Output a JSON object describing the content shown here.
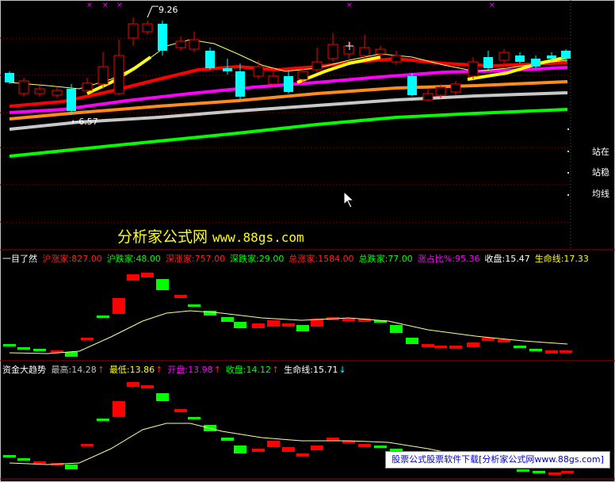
{
  "colors": {
    "background": "#000000",
    "up": "#ff0000",
    "down": "#00ffff",
    "ma_yellow": "#ffff00",
    "ma_red": "#ff0000",
    "ma_magenta": "#ff00ff",
    "ma_orange": "#ff8c1a",
    "ma_silver": "#c8c8c8",
    "ma_green": "#00ff00",
    "grid": "#8b0000"
  },
  "main_chart": {
    "high_marker": "9.26",
    "low_marker": "6.57",
    "right_labels": [
      "站在",
      "站稳",
      "均线"
    ]
  },
  "watermark": {
    "name": "分析家公式网",
    "url": "www.88gs.com"
  },
  "panel1": {
    "title": "一目了然",
    "items": [
      {
        "label": "沪涨家:",
        "value": "827.00",
        "color": "#ff2020"
      },
      {
        "label": "沪跌家:",
        "value": "48.00",
        "color": "#00ff00"
      },
      {
        "label": "深涨家:",
        "value": "757.00",
        "color": "#ff2020"
      },
      {
        "label": "深跌家:",
        "value": "29.00",
        "color": "#00ff00"
      },
      {
        "label": "总涨家:",
        "value": "1584.00",
        "color": "#ff2020"
      },
      {
        "label": "总跌家:",
        "value": "77.00",
        "color": "#00ff00"
      },
      {
        "label": "涨占比%:",
        "value": "95.36",
        "color": "#ff00ff"
      },
      {
        "label": "收盘:",
        "value": "15.47",
        "color": "#ffffff"
      },
      {
        "label": "生命线:",
        "value": "17.33",
        "color": "#ffff00"
      }
    ]
  },
  "panel2": {
    "title": "资金大趋势",
    "items": [
      {
        "label": "最高:",
        "value": "14.28",
        "color": "#c0c0c0",
        "arrow": "↑",
        "arrow_color": "#ff2020"
      },
      {
        "label": "最低:",
        "value": "13.86",
        "color": "#ffff00",
        "arrow": "↑",
        "arrow_color": "#ff2020"
      },
      {
        "label": "开盘:",
        "value": "13.98",
        "color": "#ff00ff",
        "arrow": "↑",
        "arrow_color": "#ff2020"
      },
      {
        "label": "收盘:",
        "value": "14.12",
        "color": "#00ff00",
        "arrow": "↑",
        "arrow_color": "#ff2020"
      },
      {
        "label": "生命线:",
        "value": "15.71",
        "color": "#ffffff",
        "arrow": "↓",
        "arrow_color": "#00ffff"
      }
    ]
  },
  "banner": {
    "text": "股票公式股票软件下载[分析家公式网www.88gs.com]"
  }
}
